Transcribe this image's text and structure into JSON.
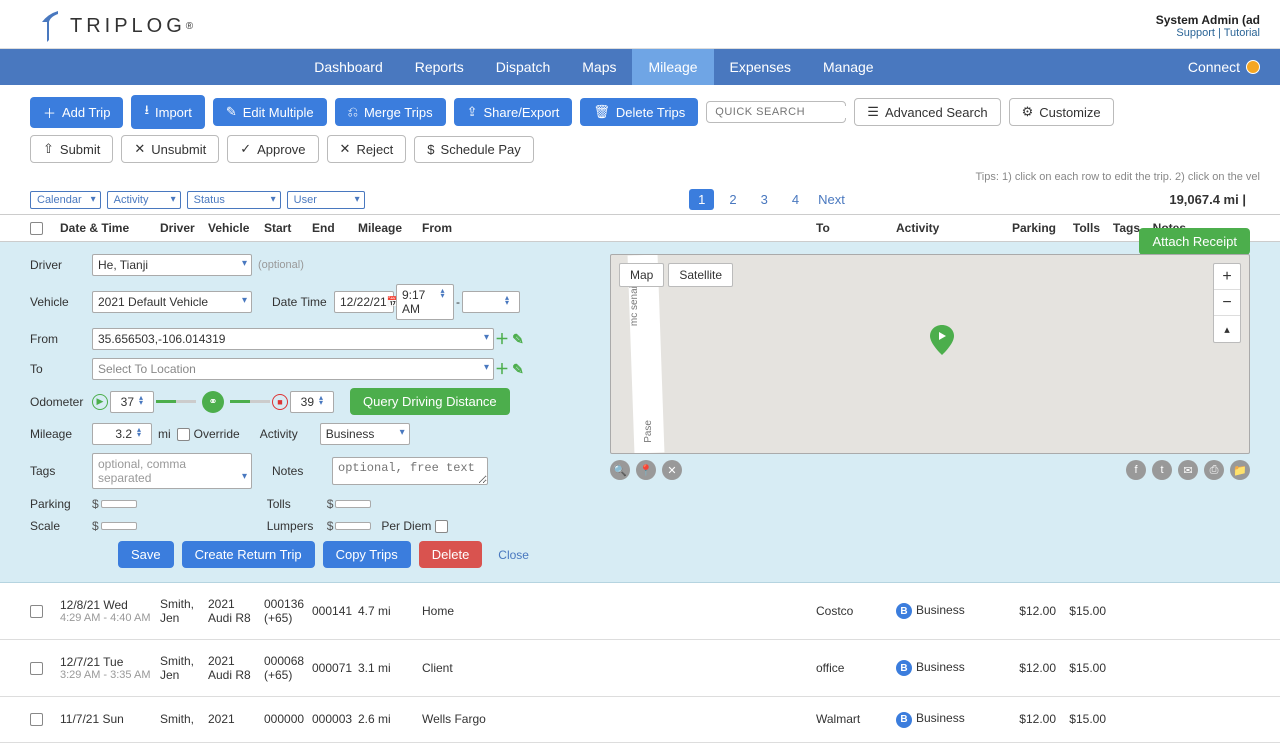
{
  "brand": "TRIPLOG",
  "user": {
    "name": "System Admin (ad",
    "support": "Support",
    "tutorial": "Tutorial"
  },
  "nav": {
    "items": [
      "Dashboard",
      "Reports",
      "Dispatch",
      "Maps",
      "Mileage",
      "Expenses",
      "Manage"
    ],
    "connect": "Connect"
  },
  "toolbar1": {
    "add": "Add Trip",
    "import": "Import",
    "edit": "Edit Multiple",
    "merge": "Merge Trips",
    "share": "Share/Export",
    "delete": "Delete Trips",
    "search_ph": "QUICK SEARCH",
    "advanced": "Advanced Search",
    "customize": "Customize"
  },
  "toolbar2": {
    "submit": "Submit",
    "unsubmit": "Unsubmit",
    "approve": "Approve",
    "reject": "Reject",
    "schedule": "Schedule Pay"
  },
  "tips": "Tips: 1) click on each row to edit the trip. 2) click on the vel",
  "filters": {
    "calendar": "Calendar",
    "activity": "Activity",
    "status": "Status",
    "user": "User"
  },
  "pager": {
    "pages": [
      "1",
      "2",
      "3",
      "4"
    ],
    "next": "Next"
  },
  "total": "19,067.4 mi |",
  "cols": {
    "date": "Date & Time",
    "driver": "Driver",
    "vehicle": "Vehicle",
    "start": "Start",
    "end": "End",
    "mileage": "Mileage",
    "from": "From",
    "to": "To",
    "activity": "Activity",
    "parking": "Parking",
    "tolls": "Tolls",
    "tags": "Tags",
    "notes": "Notes"
  },
  "form": {
    "driver_lbl": "Driver",
    "driver_val": "He, Tianji",
    "driver_opt": "(optional)",
    "vehicle_lbl": "Vehicle",
    "vehicle_val": "2021 Default Vehicle",
    "datetime_lbl": "Date Time",
    "date_val": "12/22/21",
    "time_val": "9:17 AM",
    "dash": "-",
    "from_lbl": "From",
    "from_val": "35.656503,-106.014319",
    "to_lbl": "To",
    "to_ph": "Select To Location",
    "odo_lbl": "Odometer",
    "odo_start": "37",
    "odo_end": "39",
    "query": "Query Driving Distance",
    "mileage_lbl": "Mileage",
    "mileage_val": "3.2",
    "mi": "mi",
    "override": "Override",
    "activity_lbl": "Activity",
    "activity_val": "Business",
    "tags_lbl": "Tags",
    "tags_ph": "optional, comma separated",
    "notes_lbl": "Notes",
    "notes_ph": "optional, free text",
    "parking_lbl": "Parking",
    "tolls_lbl": "Tolls",
    "scale_lbl": "Scale",
    "lumpers_lbl": "Lumpers",
    "perdiem": "Per Diem",
    "save": "Save",
    "return": "Create Return Trip",
    "copy": "Copy Trips",
    "delete": "Delete",
    "close": "Close",
    "attach": "Attach Receipt",
    "map": {
      "map": "Map",
      "satellite": "Satellite",
      "road": "mc senaida",
      "road2": "Pase"
    }
  },
  "trips": [
    {
      "date": "12/8/21 Wed",
      "time": "4:29 AM - 4:40 AM",
      "driver": "Smith, Jen",
      "vehicle": "2021 Audi R8",
      "start": "000136 (+65)",
      "end": "000141",
      "mileage": "4.7 mi",
      "from": "Home",
      "to": "Costco",
      "activity": "Business",
      "parking": "$12.00",
      "tolls": "$15.00"
    },
    {
      "date": "12/7/21 Tue",
      "time": "3:29 AM - 3:35 AM",
      "driver": "Smith, Jen",
      "vehicle": "2021 Audi R8",
      "start": "000068 (+65)",
      "end": "000071",
      "mileage": "3.1 mi",
      "from": "Client",
      "to": "office",
      "activity": "Business",
      "parking": "$12.00",
      "tolls": "$15.00"
    },
    {
      "date": "11/7/21 Sun",
      "time": "",
      "driver": "Smith,",
      "vehicle": "2021",
      "start": "000000",
      "end": "000003",
      "mileage": "2.6 mi",
      "from": "Wells Fargo",
      "to": "Walmart",
      "activity": "Business",
      "parking": "$12.00",
      "tolls": "$15.00"
    }
  ]
}
